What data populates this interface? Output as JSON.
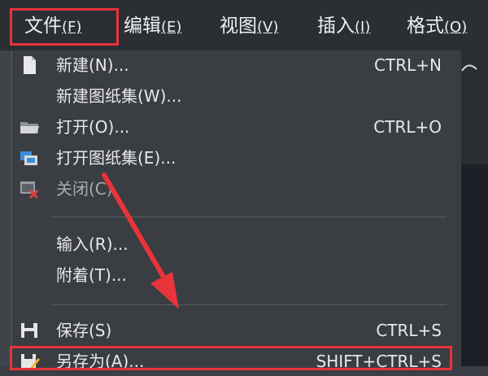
{
  "menubar": {
    "items": [
      {
        "label": "文件",
        "key": "(F)"
      },
      {
        "label": "编辑",
        "key": "(E)"
      },
      {
        "label": "视图",
        "key": "(V)"
      },
      {
        "label": "插入",
        "key": "(I)"
      },
      {
        "label": "格式",
        "key": "(O)"
      }
    ]
  },
  "file_menu": {
    "items": [
      {
        "label": "新建(N)...",
        "shortcut": "CTRL+N",
        "icon": "new-file-icon"
      },
      {
        "label": "新建图纸集(W)...",
        "shortcut": "",
        "icon": ""
      },
      {
        "label": "打开(O)...",
        "shortcut": "CTRL+O",
        "icon": "open-folder-icon"
      },
      {
        "label": "打开图纸集(E)...",
        "shortcut": "",
        "icon": "open-sheetset-icon"
      },
      {
        "label": "关闭(C)",
        "shortcut": "",
        "icon": "close-drawing-icon"
      },
      {
        "label": "输入(R)...",
        "shortcut": "",
        "icon": ""
      },
      {
        "label": "附着(T)...",
        "shortcut": "",
        "icon": ""
      },
      {
        "label": "保存(S)",
        "shortcut": "CTRL+S",
        "icon": "save-icon"
      },
      {
        "label": "另存为(A)...",
        "shortcut": "SHIFT+CTRL+S",
        "icon": "save-as-icon"
      }
    ]
  },
  "colors": {
    "highlight": "#e8343a",
    "menubar_bg": "#2b2e33",
    "menu_bg": "#3a3d41"
  }
}
